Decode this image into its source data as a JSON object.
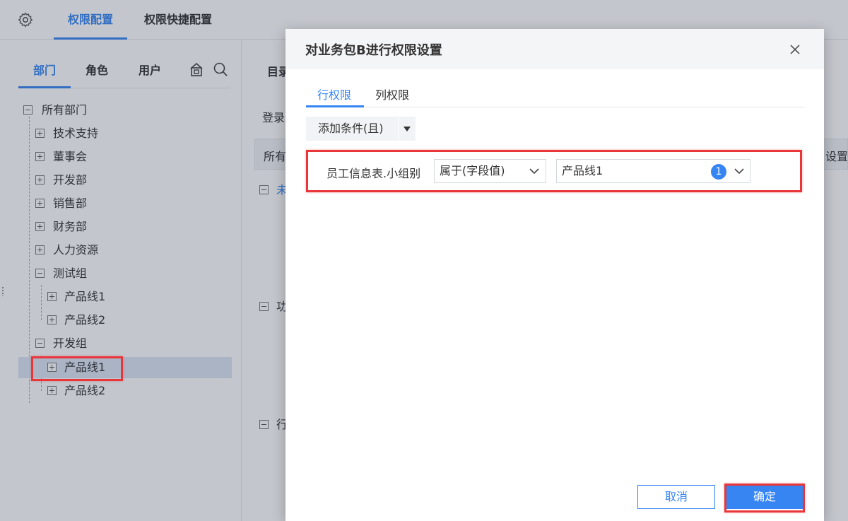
{
  "topbar": {
    "tabs": [
      {
        "label": "权限配置",
        "active": true
      },
      {
        "label": "权限快捷配置",
        "active": false
      }
    ]
  },
  "left_panel": {
    "tabs": [
      {
        "label": "部门",
        "active": true
      },
      {
        "label": "角色",
        "active": false
      },
      {
        "label": "用户",
        "active": false
      }
    ],
    "tools": [
      "lock-icon",
      "search-icon"
    ],
    "tree": [
      {
        "label": "所有部门",
        "level": 0,
        "expanded": true
      },
      {
        "label": "技术支持",
        "level": 1,
        "expanded": false
      },
      {
        "label": "董事会",
        "level": 1,
        "expanded": false
      },
      {
        "label": "开发部",
        "level": 1,
        "expanded": false
      },
      {
        "label": "销售部",
        "level": 1,
        "expanded": false
      },
      {
        "label": "财务部",
        "level": 1,
        "expanded": false
      },
      {
        "label": "人力资源",
        "level": 1,
        "expanded": false
      },
      {
        "label": "测试组",
        "level": 1,
        "expanded": true
      },
      {
        "label": "产品线1",
        "level": 2,
        "expanded": false
      },
      {
        "label": "产品线2",
        "level": 2,
        "expanded": false
      },
      {
        "label": "开发组",
        "level": 1,
        "expanded": true
      },
      {
        "label": "产品线1",
        "level": 2,
        "expanded": false,
        "selected": true
      },
      {
        "label": "产品线2",
        "level": 2,
        "expanded": false
      }
    ]
  },
  "mid_panel": {
    "tab": "目录",
    "login_label": "登录",
    "header_col1": "所有",
    "header_col2": "设置",
    "group_labels": [
      "未",
      "功",
      "行"
    ]
  },
  "dialog": {
    "title": "对业务包B进行权限设置",
    "tabs": [
      {
        "label": "行权限",
        "active": true
      },
      {
        "label": "列权限",
        "active": false
      }
    ],
    "add_condition": "添加条件(且)",
    "condition": {
      "field": "员工信息表.小组别",
      "operator": "属于(字段值)",
      "value": "产品线1",
      "value_count": "1"
    },
    "cancel": "取消",
    "ok": "确定"
  },
  "colors": {
    "accent": "#3685f2",
    "highlight": "#e8363a"
  }
}
